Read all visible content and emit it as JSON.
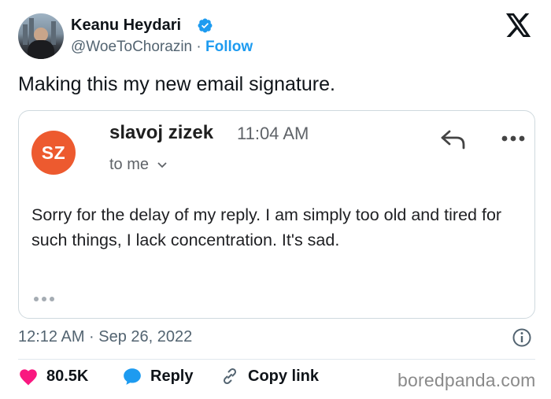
{
  "author": {
    "name": "Keanu Heydari",
    "handle": "@WoeToChorazin",
    "separator": "·",
    "follow_label": "Follow"
  },
  "tweet": {
    "text": "Making this my new email signature.",
    "timestamp": "12:12 AM · Sep 26, 2022"
  },
  "email": {
    "avatar_initials": "SZ",
    "avatar_color": "#ed5a2f",
    "sender": "slavoj zizek",
    "time": "11:04 AM",
    "recipient": "to me",
    "body": "Sorry for the delay of my reply. I am simply too old and tired for such things, I lack concentration. It's sad."
  },
  "actions": {
    "likes": "80.5K",
    "reply": "Reply",
    "copy_link": "Copy link"
  },
  "watermark": "boredpanda.com",
  "colors": {
    "accent": "#1d9bf0",
    "like": "#f91880",
    "muted": "#536471"
  }
}
